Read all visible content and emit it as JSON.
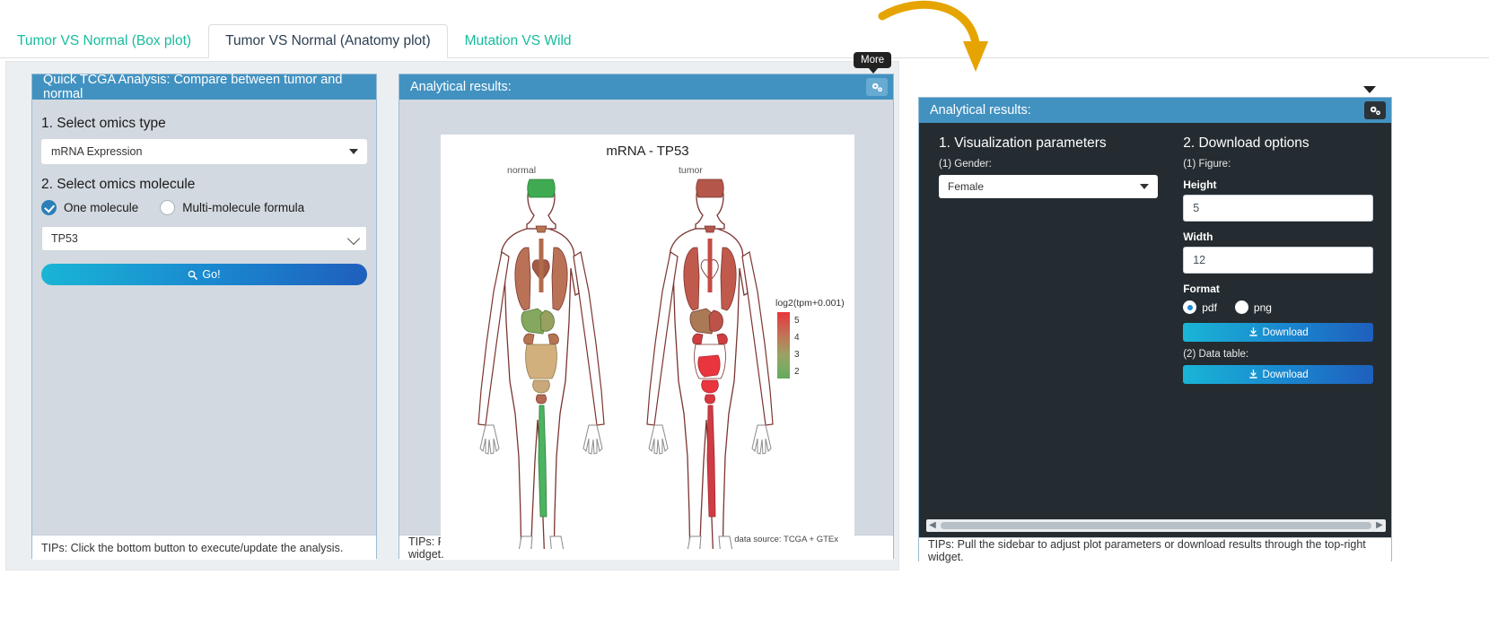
{
  "tabs": [
    {
      "label": "Tumor VS Normal (Box plot)",
      "active": false
    },
    {
      "label": "Tumor VS Normal (Anatomy plot)",
      "active": true
    },
    {
      "label": "Mutation VS Wild",
      "active": false
    }
  ],
  "left_panel": {
    "title": "Quick TCGA Analysis: Compare between tumor and normal",
    "step1_label": "1. Select omics type",
    "omics_type_value": "mRNA Expression",
    "step2_label": "2. Select omics molecule",
    "radio_one": "One molecule",
    "radio_multi": "Multi-molecule formula",
    "molecule_value": "TP53",
    "go_label": "Go!",
    "go_icon": "search-icon",
    "footer": "TIPs: Click the bottom button to execute/update the analysis."
  },
  "mid_panel": {
    "title": "Analytical results:",
    "gear_icon": "gears-icon",
    "footer": "TIPs: Pull the sidebar to adjust plot parameters or download results through the top-right widget."
  },
  "tooltip": {
    "label": "More"
  },
  "chart_data": {
    "type": "heatmap",
    "title": "mRNA - TP53",
    "subtitle": "",
    "xlabel": "",
    "ylabel": "",
    "group_labels": [
      "normal",
      "tumor"
    ],
    "legend_title": "log2(tpm+0.001)",
    "legend_ticks": [
      "5",
      "4",
      "3",
      "2"
    ],
    "legend_range": [
      2,
      5
    ],
    "colormap_low": "#5da355",
    "colormap_mid": "#b08a5c",
    "colormap_high": "#e8353e",
    "source_note": "data source: TCGA + GTEx",
    "series": [
      {
        "name": "normal",
        "organs": [
          {
            "organ": "brain",
            "value": 2.2,
            "color": "#3faa52"
          },
          {
            "organ": "thyroid",
            "value": 4.3,
            "color": "#b5764f"
          },
          {
            "organ": "esophagus",
            "value": 4.4,
            "color": "#b06b4b"
          },
          {
            "organ": "lung",
            "value": 4.3,
            "color": "#b5764f"
          },
          {
            "organ": "heart",
            "value": 4.2,
            "color": "#b5764f"
          },
          {
            "organ": "liver",
            "value": 3.8,
            "color": "#9aa05f"
          },
          {
            "organ": "stomach",
            "value": 3.5,
            "color": "#86a75e"
          },
          {
            "organ": "pancreas",
            "value": 3.9,
            "color": "#a3945b"
          },
          {
            "organ": "kidney",
            "value": 4.3,
            "color": "#b5764f"
          },
          {
            "organ": "colon",
            "value": 4.0,
            "color": "#ad8a58"
          },
          {
            "organ": "bladder",
            "value": 3.6,
            "color": "#94a05e"
          },
          {
            "organ": "uterus",
            "value": 3.9,
            "color": "#a8905a"
          },
          {
            "organ": "muscle",
            "value": 4.2,
            "color": "#b5764f"
          },
          {
            "organ": "vessel",
            "value": 2.6,
            "color": "#4faa58"
          }
        ]
      },
      {
        "name": "tumor",
        "organs": [
          {
            "organ": "brain",
            "value": 4.6,
            "color": "#b4564a"
          },
          {
            "organ": "thyroid",
            "value": 4.6,
            "color": "#b4564a"
          },
          {
            "organ": "esophagus",
            "value": 4.8,
            "color": "#c44b45"
          },
          {
            "organ": "lung",
            "value": 4.7,
            "color": "#bd524a"
          },
          {
            "organ": "heart",
            "value": 4.6,
            "color": "#b4564a"
          },
          {
            "organ": "liver",
            "value": 4.5,
            "color": "#b05a4c"
          },
          {
            "organ": "stomach",
            "value": 4.7,
            "color": "#bd524a"
          },
          {
            "organ": "pancreas",
            "value": 4.4,
            "color": "#a97a55"
          },
          {
            "organ": "kidney",
            "value": 4.9,
            "color": "#d03c40"
          },
          {
            "organ": "colon",
            "value": 5.0,
            "color": "#e8353e"
          },
          {
            "organ": "bladder",
            "value": 5.0,
            "color": "#e8353e"
          },
          {
            "organ": "uterus",
            "value": 4.9,
            "color": "#d6373f"
          },
          {
            "organ": "muscle",
            "value": 4.6,
            "color": "#b4564a"
          },
          {
            "organ": "vessel",
            "value": 4.5,
            "color": "#b05a4c"
          }
        ]
      }
    ]
  },
  "right_panel": {
    "title": "Analytical results:",
    "gear_icon": "gears-icon",
    "section1_title": "1. Visualization parameters",
    "gender_label": "(1) Gender:",
    "gender_value": "Female",
    "section2_title": "2. Download options",
    "figure_label": "(1) Figure:",
    "height_label": "Height",
    "height_value": "5",
    "width_label": "Width",
    "width_value": "12",
    "format_label": "Format",
    "format_pdf": "pdf",
    "format_png": "png",
    "download_figure_label": "Download",
    "download_icon": "download-icon",
    "datatable_label": "(2) Data table:",
    "download_table_label": "Download",
    "footer": "TIPs: Pull the sidebar to adjust plot parameters or download results through the top-right widget."
  }
}
